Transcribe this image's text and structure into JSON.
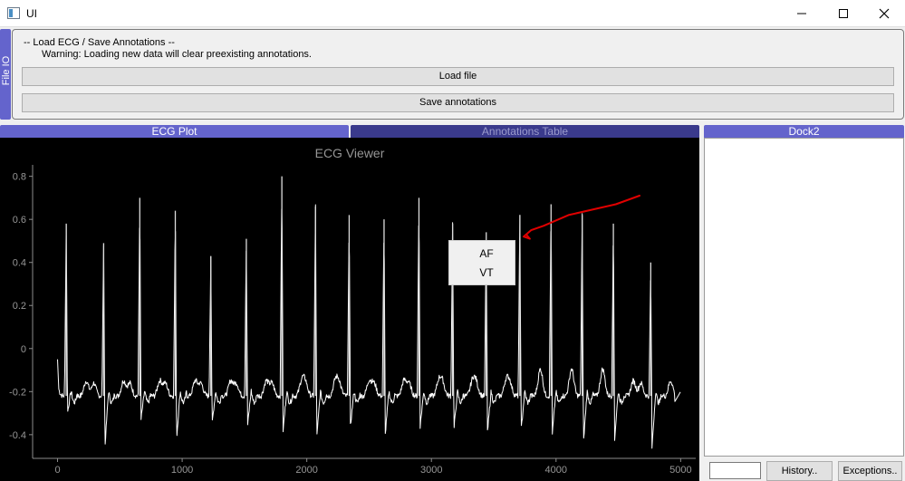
{
  "window": {
    "title": "UI"
  },
  "file_io": {
    "dock_label": "File IO",
    "heading": "-- Load ECG / Save Annotations --",
    "warning": "Warning: Loading new data will clear preexisting annotations.",
    "load_label": "Load file",
    "save_label": "Save annotations"
  },
  "tabs": {
    "ecg_plot": "ECG Plot",
    "annotations_table": "Annotations Table",
    "dock2": "Dock2"
  },
  "context_menu": {
    "items": [
      "AF",
      "VT"
    ]
  },
  "dock2": {
    "history_label": "History..",
    "exceptions_label": "Exceptions..",
    "input_value": ""
  },
  "colors": {
    "dock_tab": "#6464cc",
    "dock_tab_inactive": "#3a3a8c",
    "plot_bg": "#000000",
    "trace": "#ffffff",
    "annotation_stroke": "#e00000"
  },
  "icons": {
    "app": "app-window-icon",
    "minimize": "minimize-icon",
    "maximize": "maximize-icon",
    "close": "close-icon"
  },
  "chart_data": {
    "type": "line",
    "title": "ECG Viewer",
    "xlabel": "",
    "ylabel": "",
    "xlim": [
      -200,
      5150
    ],
    "ylim": [
      -0.51,
      0.87
    ],
    "x_ticks": [
      0,
      1000,
      2000,
      3000,
      4000,
      5000
    ],
    "y_ticks": [
      -0.4,
      -0.2,
      0,
      0.2,
      0.4,
      0.6,
      0.8
    ],
    "x_tick_labels": [
      "0",
      "1000",
      "2000",
      "3000",
      "4000",
      "5000"
    ],
    "y_tick_labels": [
      "-0.4",
      "-0.2",
      "0",
      "0.2",
      "0.4",
      "0.6",
      "0.8"
    ],
    "grid": false,
    "baseline": -0.22,
    "r_peaks": [
      {
        "x": 70,
        "peak": 0.58,
        "trough": -0.3
      },
      {
        "x": 370,
        "peak": 0.49,
        "trough": -0.46
      },
      {
        "x": 660,
        "peak": 0.7,
        "trough": -0.33
      },
      {
        "x": 945,
        "peak": 0.64,
        "trough": -0.42
      },
      {
        "x": 1230,
        "peak": 0.43,
        "trough": -0.35
      },
      {
        "x": 1515,
        "peak": 0.51,
        "trough": -0.36
      },
      {
        "x": 1800,
        "peak": 0.8,
        "trough": -0.38
      },
      {
        "x": 2070,
        "peak": 0.66,
        "trough": -0.42
      },
      {
        "x": 2340,
        "peak": 0.62,
        "trough": -0.36
      },
      {
        "x": 2620,
        "peak": 0.6,
        "trough": -0.4
      },
      {
        "x": 2900,
        "peak": 0.7,
        "trough": -0.36
      },
      {
        "x": 3170,
        "peak": 0.58,
        "trough": -0.38
      },
      {
        "x": 3440,
        "peak": 0.54,
        "trough": -0.39
      },
      {
        "x": 3710,
        "peak": 0.62,
        "trough": -0.38
      },
      {
        "x": 3960,
        "peak": 0.67,
        "trough": -0.4
      },
      {
        "x": 4210,
        "peak": 0.62,
        "trough": -0.44
      },
      {
        "x": 4460,
        "peak": 0.58,
        "trough": -0.42
      },
      {
        "x": 4760,
        "peak": 0.4,
        "trough": -0.46
      }
    ],
    "x_end": 5000,
    "annotation_stroke": [
      [
        4670,
        0.71
      ],
      [
        4480,
        0.67
      ],
      [
        4100,
        0.62
      ],
      [
        3900,
        0.57
      ],
      [
        3800,
        0.55
      ],
      [
        3740,
        0.52
      ],
      [
        3790,
        0.51
      ],
      [
        3760,
        0.53
      ]
    ]
  }
}
